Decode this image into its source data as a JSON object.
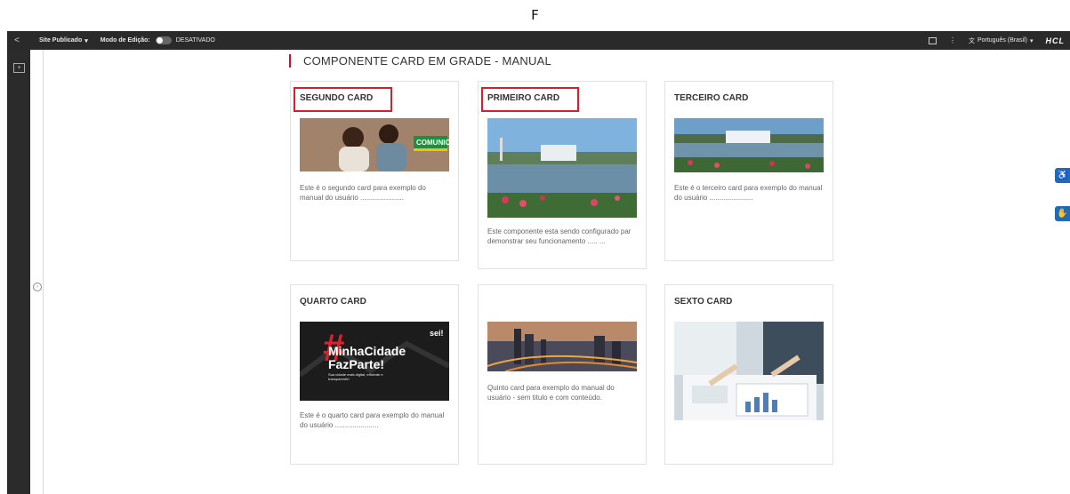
{
  "top_letter": "F",
  "toolbar": {
    "back_icon": "chevron-left-icon",
    "site_status": "Site Publicado",
    "edit_mode_label": "Modo de Edição:",
    "edit_mode_state": "DESATIVADO",
    "language": "Português (Brasil)",
    "brand": "HCL"
  },
  "page": {
    "heading": "COMPONENTE CARD EM GRADE - MANUAL",
    "accent_color": "#c8102e"
  },
  "cards": [
    {
      "title": "SEGUNDO CARD",
      "description": "Este é o segundo card para exemplo do manual do usuário ......................",
      "image": "children-comunica-photo",
      "image_text": "COMUNICA"
    },
    {
      "title": "PRIMEIRO CARD",
      "description": "Este componente esta sendo configurado par demonstrar seu funcionamento ..... ...",
      "image": "park-lake-fountain-photo"
    },
    {
      "title": "TERCEIRO CARD",
      "description": "Este é o terceiro card para exemplo do manual do usuário ......................",
      "image": "park-lake-fountain-photo"
    },
    {
      "title": "QUARTO CARD",
      "description": "Este é o quarto card para exemplo do manual do usuário ......................",
      "image": "minha-cidade-banner",
      "banner_hash": "#",
      "banner_line1": "MinhaCidade",
      "banner_line2": "FazParte!",
      "banner_small": "Sua cidade mais digital, eficiente e transparente!",
      "banner_logo": "sei!"
    },
    {
      "title": "",
      "description": "Quinto card para exemplo do manual do usuário -  sem titulo e com conteúdo.",
      "image": "city-skyline-photo"
    },
    {
      "title": "SEXTO CARD",
      "description": "",
      "image": "office-documents-photo"
    }
  ]
}
